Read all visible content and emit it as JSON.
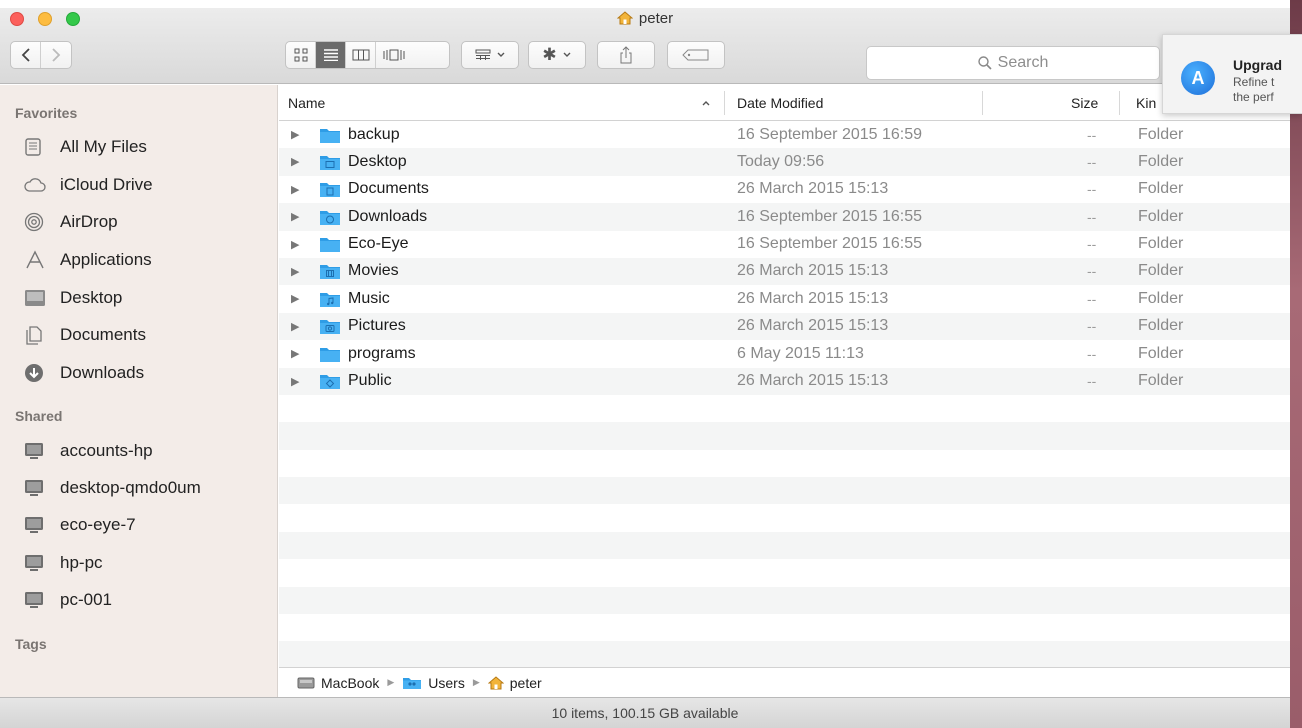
{
  "window": {
    "title": "peter"
  },
  "toolbar": {
    "search_placeholder": "Search"
  },
  "notification": {
    "title": "Upgrad",
    "line1": "Refine t",
    "line2": "the perf"
  },
  "sidebar": {
    "favorites_label": "Favorites",
    "favorites": [
      {
        "label": "All My Files",
        "icon": "all-files-icon"
      },
      {
        "label": "iCloud Drive",
        "icon": "cloud-icon"
      },
      {
        "label": "AirDrop",
        "icon": "airdrop-icon"
      },
      {
        "label": "Applications",
        "icon": "applications-icon"
      },
      {
        "label": "Desktop",
        "icon": "desktop-icon"
      },
      {
        "label": "Documents",
        "icon": "documents-icon"
      },
      {
        "label": "Downloads",
        "icon": "downloads-icon"
      }
    ],
    "shared_label": "Shared",
    "shared": [
      {
        "label": "accounts-hp",
        "icon": "computer-icon"
      },
      {
        "label": "desktop-qmdo0um",
        "icon": "computer-icon"
      },
      {
        "label": "eco-eye-7",
        "icon": "computer-icon"
      },
      {
        "label": "hp-pc",
        "icon": "computer-icon"
      },
      {
        "label": "pc-001",
        "icon": "computer-icon"
      }
    ],
    "tags_label": "Tags"
  },
  "list": {
    "columns": {
      "name": "Name",
      "date": "Date Modified",
      "size": "Size",
      "kind": "Kin"
    },
    "rows": [
      {
        "name": "backup",
        "date": "16 September 2015 16:59",
        "size": "--",
        "kind": "Folder"
      },
      {
        "name": "Desktop",
        "date": "Today 09:56",
        "size": "--",
        "kind": "Folder"
      },
      {
        "name": "Documents",
        "date": "26 March 2015 15:13",
        "size": "--",
        "kind": "Folder"
      },
      {
        "name": "Downloads",
        "date": "16 September 2015 16:55",
        "size": "--",
        "kind": "Folder"
      },
      {
        "name": "Eco-Eye",
        "date": "16 September 2015 16:55",
        "size": "--",
        "kind": "Folder"
      },
      {
        "name": "Movies",
        "date": "26 March 2015 15:13",
        "size": "--",
        "kind": "Folder"
      },
      {
        "name": "Music",
        "date": "26 March 2015 15:13",
        "size": "--",
        "kind": "Folder"
      },
      {
        "name": "Pictures",
        "date": "26 March 2015 15:13",
        "size": "--",
        "kind": "Folder"
      },
      {
        "name": "programs",
        "date": "6 May 2015 11:13",
        "size": "--",
        "kind": "Folder"
      },
      {
        "name": "Public",
        "date": "26 March 2015 15:13",
        "size": "--",
        "kind": "Folder"
      }
    ]
  },
  "pathbar": {
    "items": [
      "MacBook",
      "Users",
      "peter"
    ]
  },
  "status": {
    "text": "10 items, 100.15 GB available"
  },
  "colors": {
    "folder": "#3aa6ea",
    "sidebar_bg": "#f3ece8",
    "active_segment": "#6b6b6b"
  }
}
